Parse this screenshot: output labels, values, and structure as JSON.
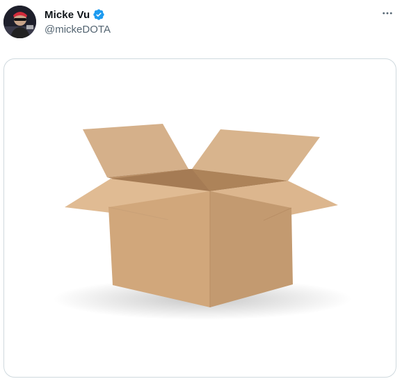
{
  "tweet": {
    "author": {
      "display_name": "Micke Vu",
      "handle": "@mickeDOTA",
      "verified": true
    },
    "media": {
      "type": "photo",
      "subject": "open cardboard box"
    }
  },
  "icons": {
    "verified": "verified-badge-icon",
    "more": "more-horizontal-icon"
  },
  "colors": {
    "name": "#0f1419",
    "handle": "#536471",
    "verified": "#1d9bf0",
    "border": "#cfd9de",
    "cardboard": "#d2a97e"
  }
}
